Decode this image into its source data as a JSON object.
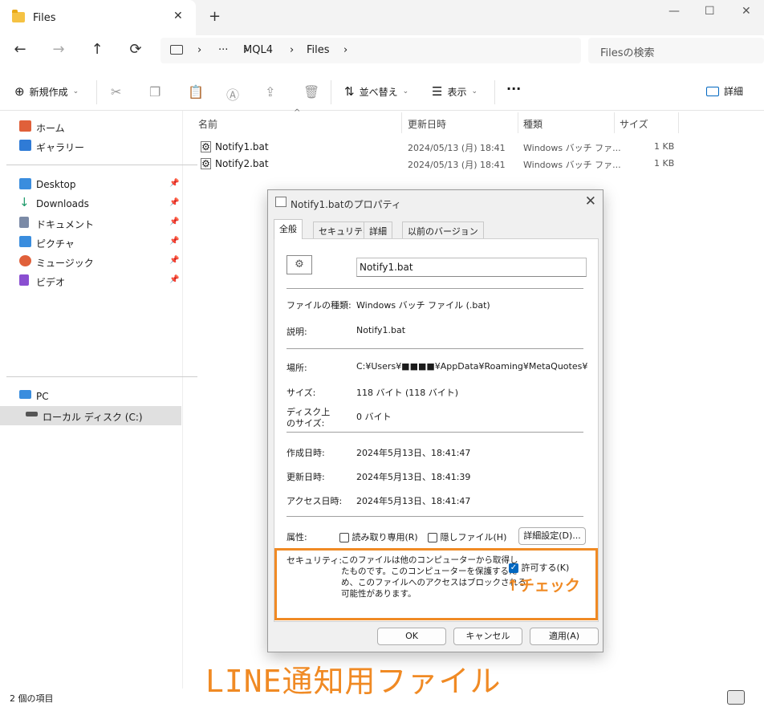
{
  "window": {
    "tab_title": "Files",
    "new_tab": "+",
    "minimize": "—",
    "maximize": "☐",
    "close": "✕",
    "tab_close": "✕"
  },
  "nav": {
    "back": "←",
    "forward": "→",
    "up": "↑",
    "refresh": "⟳"
  },
  "breadcrumb": {
    "more": "···",
    "items": [
      "MQL4",
      "Files"
    ]
  },
  "search": {
    "placeholder": "Filesの検索"
  },
  "toolbar": {
    "new_label": "新規作成",
    "sort_label": "並べ替え",
    "view_label": "表示",
    "more": "···",
    "details_label": "詳細"
  },
  "sidebar": {
    "top": [
      {
        "label": "ホーム",
        "icon": "home-icon",
        "color": "#e0603a"
      },
      {
        "label": "ギャラリー",
        "icon": "gallery-icon",
        "color": "#2f7bd6"
      }
    ],
    "pinned": [
      {
        "label": "Desktop",
        "icon": "desktop-icon",
        "color": "#3a8dde"
      },
      {
        "label": "Downloads",
        "icon": "download-icon",
        "color": "#1e9a6a"
      },
      {
        "label": "ドキュメント",
        "icon": "document-icon",
        "color": "#7b8aa6"
      },
      {
        "label": "ピクチャ",
        "icon": "pictures-icon",
        "color": "#3a8dde"
      },
      {
        "label": "ミュージック",
        "icon": "music-icon",
        "color": "#e0603a"
      },
      {
        "label": "ビデオ",
        "icon": "video-icon",
        "color": "#8a4fd1"
      }
    ],
    "pin": "📌",
    "pc_label": "PC",
    "disk_label": "ローカル ディスク (C:)"
  },
  "columns": {
    "name": "名前",
    "modified": "更新日時",
    "type": "種類",
    "size": "サイズ"
  },
  "files": [
    {
      "name": "Notify1.bat",
      "modified": "2024/05/13 (月) 18:41",
      "type": "Windows バッチ ファ...",
      "size": "1 KB"
    },
    {
      "name": "Notify2.bat",
      "modified": "2024/05/13 (月) 18:41",
      "type": "Windows バッチ ファ...",
      "size": "1 KB"
    }
  ],
  "status": {
    "count": "2 個の項目"
  },
  "dialog": {
    "title": "Notify1.batのプロパティ",
    "tabs": [
      "全般",
      "セキュリティ",
      "詳細",
      "以前のバージョン"
    ],
    "filename": "Notify1.bat",
    "rows": {
      "type_label": "ファイルの種類:",
      "type_value": "Windows バッチ ファイル (.bat)",
      "desc_label": "説明:",
      "desc_value": "Notify1.bat",
      "location_label": "場所:",
      "location_value": "C:¥Users¥■■■■¥AppData¥Roaming¥MetaQuotes¥Termi",
      "size_label": "サイズ:",
      "size_value": "118 バイト (118 バイト)",
      "disk_label_1": "ディスク上",
      "disk_label_2": "のサイズ:",
      "disk_value": "0 バイト",
      "created_label": "作成日時:",
      "created_value": "2024年5月13日、18:41:47",
      "modified_label": "更新日時:",
      "modified_value": "2024年5月13日、18:41:39",
      "accessed_label": "アクセス日時:",
      "accessed_value": "2024年5月13日、18:41:47",
      "attr_label": "属性:",
      "readonly": "読み取り専用(R)",
      "hidden": "隠しファイル(H)",
      "advanced": "詳細設定(D)...",
      "security_label": "セキュリティ:",
      "security_text_1": "このファイルは他のコンピューターから取得し",
      "security_text_2": "たものです。このコンピューターを保護するた",
      "security_text_3": "め、このファイルへのアクセスはブロックされる",
      "security_text_4": "可能性があります。",
      "unblock": "許可する(K)",
      "unblock_checked": "✓"
    },
    "buttons": {
      "ok": "OK",
      "cancel": "キャンセル",
      "apply": "適用(A)"
    },
    "close": "✕"
  },
  "annotations": {
    "check": "↑チェック",
    "title": "LINE通知用ファイル",
    "color": "#f08a24"
  }
}
